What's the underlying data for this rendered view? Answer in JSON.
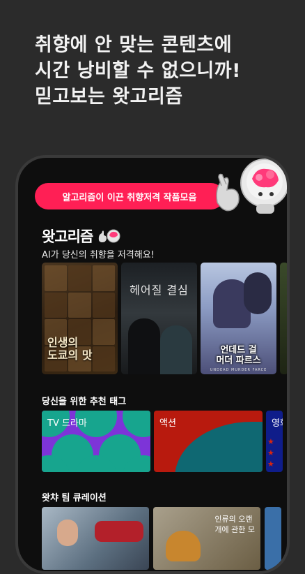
{
  "headline": {
    "line1": "취향에 안 맞는 콘텐츠에",
    "line2": "시간 낭비할 수 없으니까!",
    "line3": "믿고보는 왓고리즘"
  },
  "banner": {
    "label": "알고리즘이 이끈 취향저격 작품모음"
  },
  "brand": {
    "logo": "왓고리즘",
    "subtitle": "AI가 당신의 취향을 저격해요!"
  },
  "posters": [
    {
      "title_line1": "인생의",
      "title_line2": "도쿄의 맛"
    },
    {
      "title": "헤어질 결심"
    },
    {
      "title_line1": "언데드 걸",
      "title_line2": "머더 파르스",
      "subtitle": "UNDEAD MURDER FARCE"
    }
  ],
  "tags_section": {
    "title": "당신을 위한 추천 태그",
    "tags": [
      {
        "label": "TV 드라마"
      },
      {
        "label": "액션"
      },
      {
        "label": "영화"
      }
    ]
  },
  "curation_section": {
    "title": "왓챠 팀 큐레이션",
    "cards": [
      {
        "caption_line1": "인류의 오랜",
        "caption_line2": "개에 관한 모"
      }
    ]
  },
  "colors": {
    "accent": "#ff1f55",
    "background": "#2b2b2b",
    "phone_screen": "#0e0e0e",
    "tag_tv": "#7d34d8",
    "tag_action": "#b81a0e",
    "tag_movie": "#0f1d8a"
  }
}
